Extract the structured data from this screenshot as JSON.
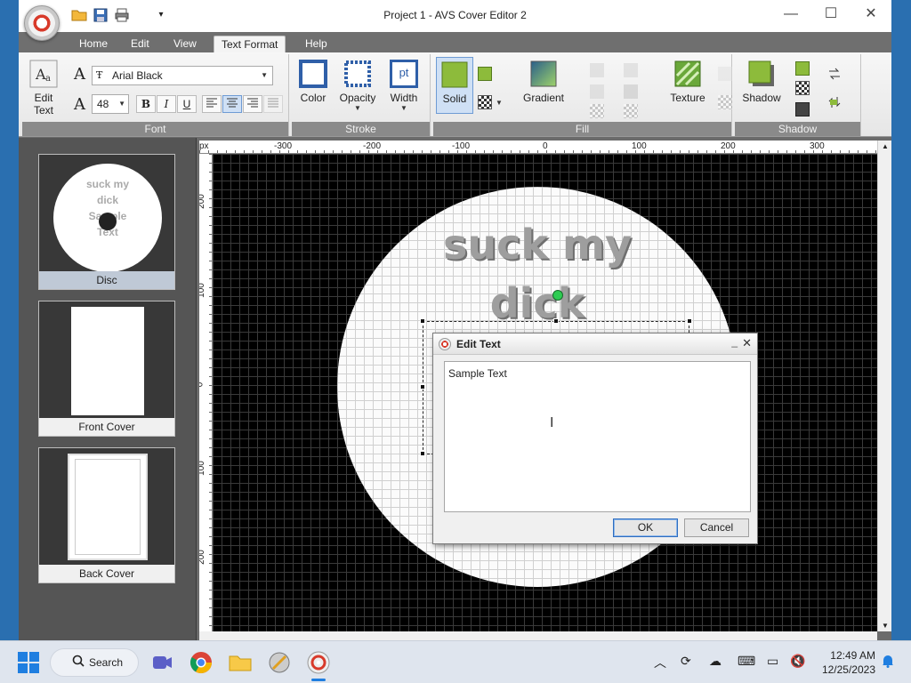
{
  "window": {
    "title": "Project 1 - AVS Cover Editor 2",
    "minimize": "—",
    "maximize": "☐",
    "close": "✕"
  },
  "menu": {
    "tabs": [
      {
        "label": "Home"
      },
      {
        "label": "Edit"
      },
      {
        "label": "View"
      },
      {
        "label": "Text Format",
        "active": true
      },
      {
        "label": "Help"
      }
    ]
  },
  "ribbon": {
    "edit_text_label_1": "Edit",
    "edit_text_label_2": "Text",
    "font_name": "Arial Black",
    "font_size": "48",
    "bold": "B",
    "italic": "I",
    "underline": "U",
    "groups": {
      "font": "Font",
      "stroke": "Stroke",
      "fill": "Fill",
      "shadow": "Shadow"
    },
    "stroke_buttons": {
      "color": "Color",
      "opacity": "Opacity",
      "width": "Width",
      "width_icon_text": "pt"
    },
    "fill_buttons": {
      "solid": "Solid",
      "gradient": "Gradient",
      "texture": "Texture"
    },
    "shadow_buttons": {
      "shadow": "Shadow"
    }
  },
  "panel": {
    "thumbnails": [
      {
        "label": "Disc",
        "selected": true
      },
      {
        "label": "Front Cover"
      },
      {
        "label": "Back Cover"
      }
    ],
    "disc_thumb_text": [
      "suck my",
      "dick",
      "Sample",
      "Text"
    ]
  },
  "rulers": {
    "unit": "px",
    "top_ticks": [
      "-300",
      "-200",
      "-100",
      "0",
      "100",
      "200",
      "300"
    ],
    "left_ticks": [
      "200",
      "100",
      "0",
      "100",
      "200"
    ]
  },
  "canvas": {
    "line1": "suck my",
    "line2": "dick"
  },
  "dialog": {
    "title": "Edit Text",
    "text_value": "Sample Text",
    "ok": "OK",
    "cancel": "Cancel"
  },
  "taskbar": {
    "search": "Search",
    "time": "12:49 AM",
    "date": "12/25/2023"
  },
  "colors": {
    "accent": "#2e6dc0",
    "canvas_bg": "#000000",
    "panel_bg": "#555555"
  }
}
